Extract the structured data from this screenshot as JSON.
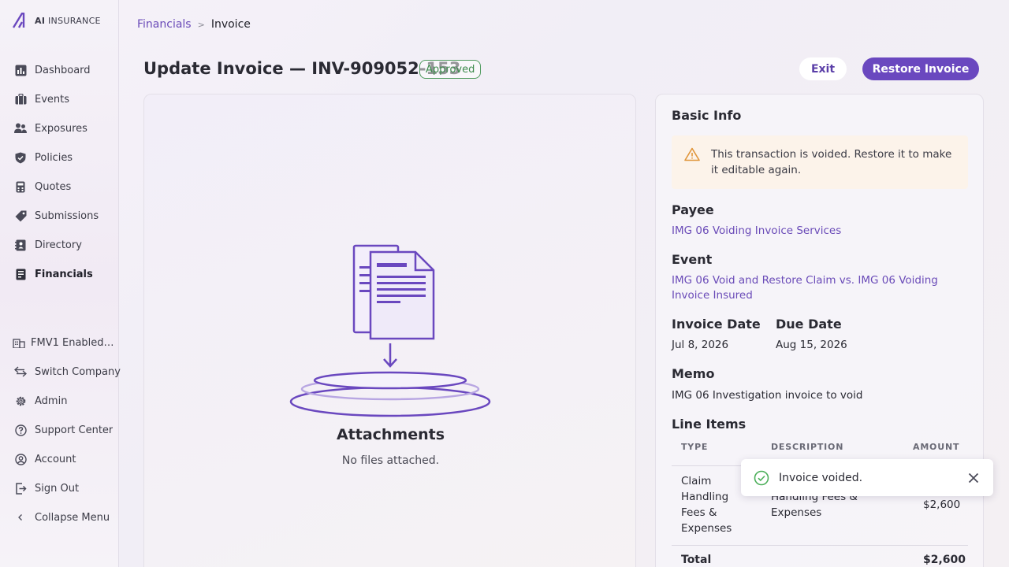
{
  "app": {
    "logo_icon": "ai-logo-icon",
    "logo_prefix": "AI",
    "logo_suffix": "INSURANCE"
  },
  "sidebar": {
    "items": [
      {
        "label": "Dashboard",
        "icon": "bar-chart-icon"
      },
      {
        "label": "Events",
        "icon": "briefcase-icon"
      },
      {
        "label": "Exposures",
        "icon": "people-icon"
      },
      {
        "label": "Policies",
        "icon": "shield-icon"
      },
      {
        "label": "Quotes",
        "icon": "calculator-icon"
      },
      {
        "label": "Submissions",
        "icon": "tag-icon"
      },
      {
        "label": "Directory",
        "icon": "contact-book-icon"
      },
      {
        "label": "Financials",
        "icon": "ledger-icon",
        "active": true
      }
    ],
    "bottom": [
      {
        "label": "FMV1 Enabled …",
        "icon": "building-icon"
      },
      {
        "label": "Switch Company",
        "icon": "switch-arrows-icon"
      },
      {
        "label": "Admin",
        "icon": "gear-icon"
      },
      {
        "label": "Support Center",
        "icon": "help-circle-icon"
      },
      {
        "label": "Account",
        "icon": "user-circle-icon"
      },
      {
        "label": "Sign Out",
        "icon": "sign-out-icon"
      },
      {
        "label": "Collapse Menu",
        "icon": "chevron-left-icon"
      }
    ]
  },
  "breadcrumb": {
    "parent": "Financials",
    "separator": ">",
    "current": "Invoice"
  },
  "header": {
    "title": "Update Invoice — INV-909052-153",
    "status": "Approved",
    "exit_label": "Exit",
    "restore_label": "Restore Invoice"
  },
  "attachments": {
    "title": "Attachments",
    "empty_text": "No files attached."
  },
  "basic_info": {
    "title": "Basic Info",
    "warning": "This transaction is voided. Restore it to make it editable again.",
    "payee_label": "Payee",
    "payee_value": "IMG 06 Voiding Invoice Services",
    "event_label": "Event",
    "event_value": "IMG 06 Void and Restore Claim vs. IMG 06 Voiding Invoice Insured",
    "invoice_date_label": "Invoice Date",
    "invoice_date_value": "Jul 8, 2026",
    "due_date_label": "Due Date",
    "due_date_value": "Aug 15, 2026",
    "memo_label": "Memo",
    "memo_value": "IMG 06 Investigation invoice to void",
    "line_items_label": "Line Items",
    "line_items": {
      "columns": [
        "TYPE",
        "DESCRIPTION",
        "AMOUNT"
      ],
      "rows": [
        {
          "type": "Claim Handling Fees & Expenses",
          "description": "Invoice to void — Claim Handling Fees & Expenses",
          "amount": "$2,600"
        }
      ],
      "total_label": "Total",
      "total_value": "$2,600"
    }
  },
  "toast": {
    "message": "Invoice voided.",
    "icon": "check-circle-icon",
    "close_icon": "close-icon"
  },
  "colors": {
    "accent": "#6a48bf",
    "link": "#6a4bb8",
    "success": "#3b8a4b",
    "warning_bg": "#fcf3ea",
    "warning_icon": "#e0953a"
  }
}
